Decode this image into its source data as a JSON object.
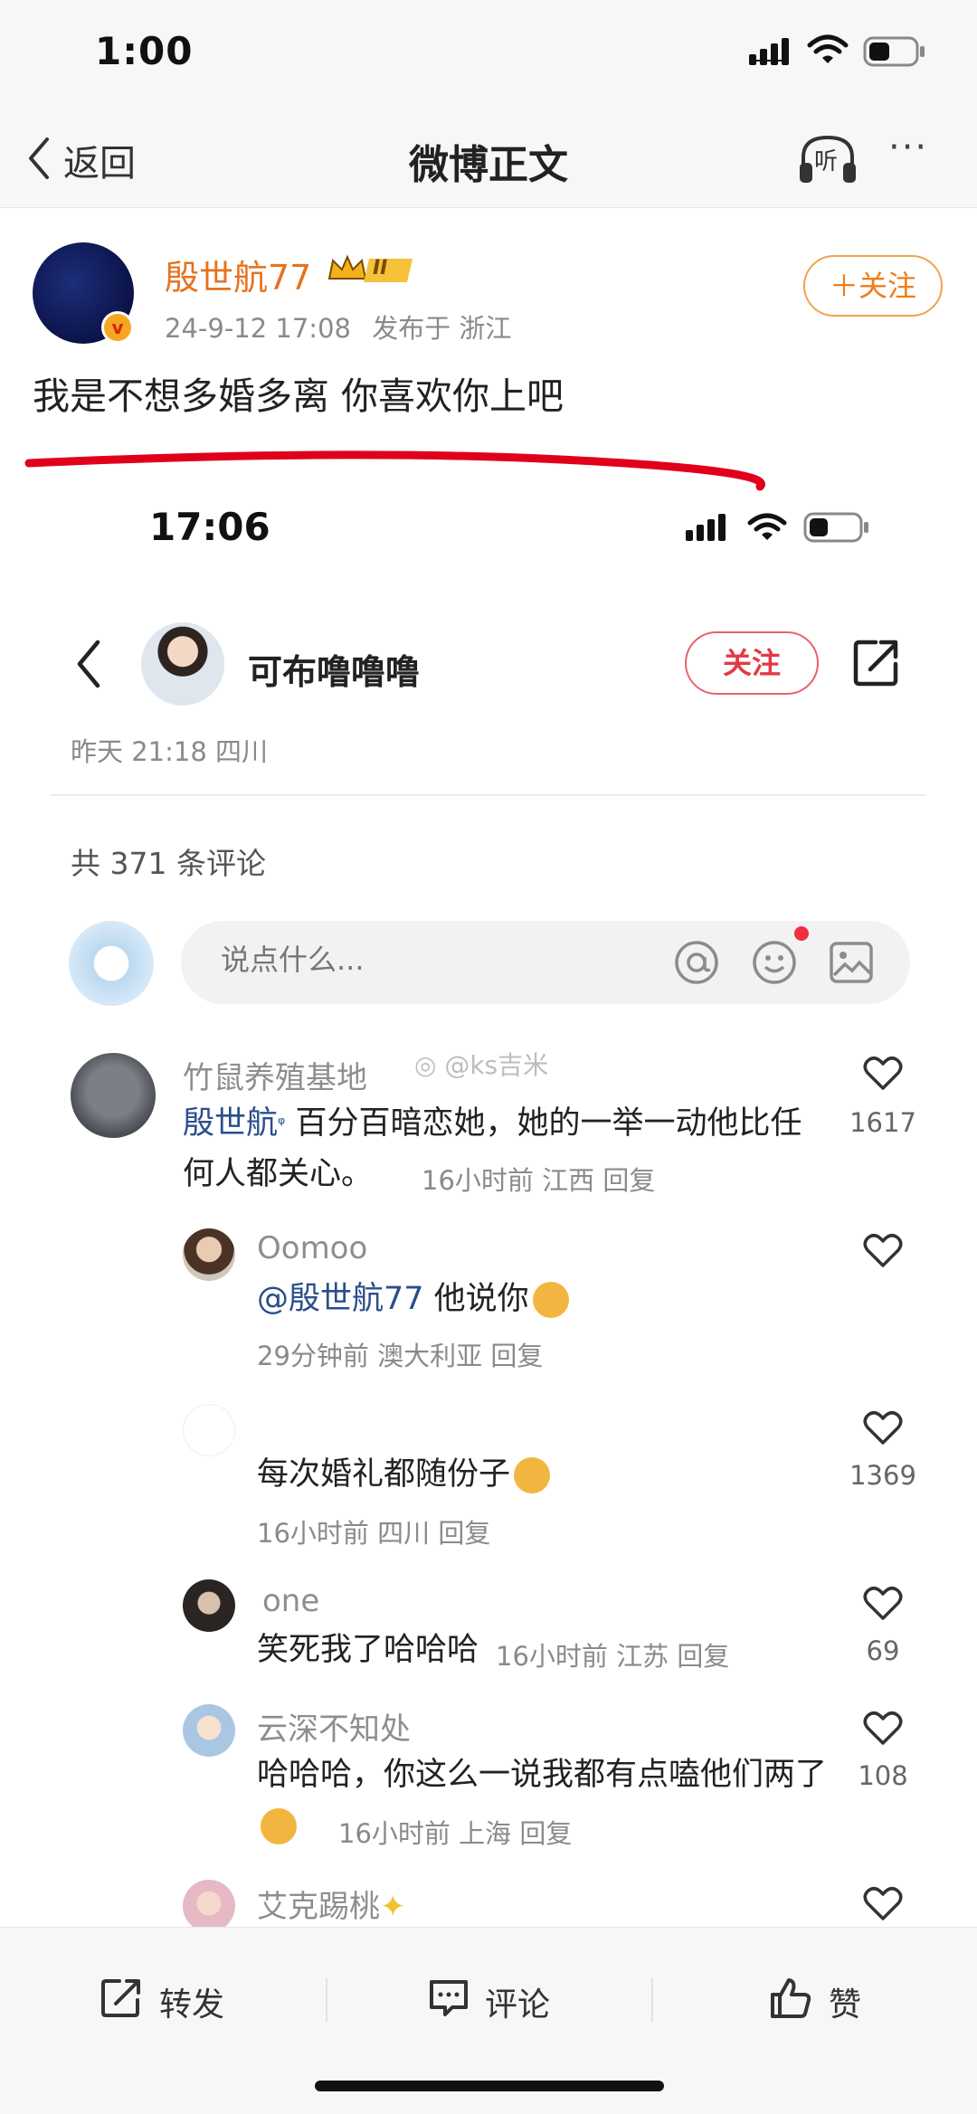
{
  "status_bar": {
    "time": "1:00"
  },
  "nav": {
    "back_label": "返回",
    "title": "微博正文",
    "listen_label": "听",
    "more_label": "···"
  },
  "post": {
    "author": "殷世航77",
    "timestamp": "24-9-12 17:08",
    "location": "发布于 浙江",
    "follow_label": "＋关注",
    "badge_roman": "II",
    "text": "我是不想多婚多离 你喜欢你上吧",
    "vip_badge": "v"
  },
  "embedded": {
    "time": "17:06",
    "username": "可布噜噜噜",
    "follow_label": "关注",
    "date": "昨天 21:18 四川",
    "comment_count": "共 371 条评论",
    "input_placeholder": "说点什么...",
    "watermark": "@ks吉米",
    "comments": [
      {
        "name": "竹鼠养殖基地",
        "mention": "殷世航",
        "text": " 百分百暗恋她，她的一举一动他比任何人都关心。",
        "meta": "16小时前 江西 回复",
        "likes": "1617"
      },
      {
        "name": "Oomoo",
        "mention": "@殷世航77",
        "text": " 他说你",
        "meta": "29分钟前 澳大利亚 回复",
        "likes": ""
      },
      {
        "name": "",
        "mention": "",
        "text": "每次婚礼都随份子",
        "meta": "16小时前 四川 回复",
        "likes": "1369"
      },
      {
        "name": "one",
        "mention": "",
        "text": "笑死我了哈哈哈",
        "meta": "16小时前 江苏 回复",
        "likes": "69"
      },
      {
        "name": "云深不知处",
        "mention": "",
        "text": "哈哈哈，你这么一说我都有点嗑他们两了",
        "meta": "16小时前 上海 回复",
        "likes": "108"
      },
      {
        "name": "艾克踢桃",
        "mention": "",
        "text": "",
        "meta": "",
        "likes": ""
      }
    ]
  },
  "bottom_bar": {
    "repost_label": "转发",
    "comment_label": "评论",
    "like_label": "赞"
  },
  "colors": {
    "accent_orange": "#e5731f",
    "red_follow": "#e23a45",
    "mention_blue": "#2b4e8c",
    "red_stroke": "#e0001b"
  }
}
